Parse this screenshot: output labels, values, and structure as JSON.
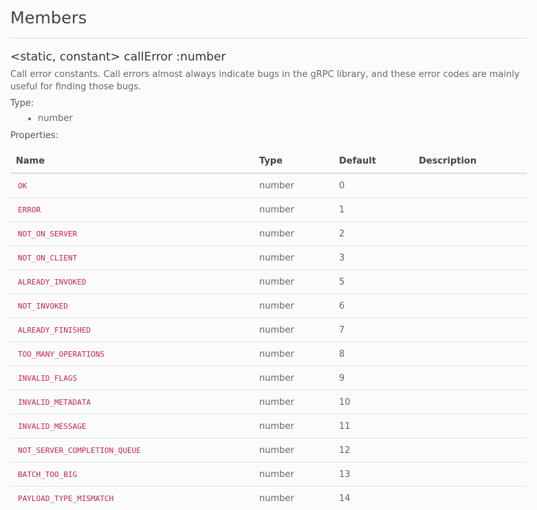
{
  "section_title": "Members",
  "member": {
    "signature": "<static, constant> callError :number",
    "description": "Call error constants. Call errors almost always indicate bugs in the gRPC library, and these error codes are mainly useful for finding those bugs.",
    "type_label": "Type:",
    "types": [
      "number"
    ],
    "properties_label": "Properties:"
  },
  "table": {
    "headers": {
      "name": "Name",
      "type": "Type",
      "default": "Default",
      "description": "Description"
    },
    "rows": [
      {
        "name": "OK",
        "type": "number",
        "default": "0",
        "description": ""
      },
      {
        "name": "ERROR",
        "type": "number",
        "default": "1",
        "description": ""
      },
      {
        "name": "NOT_ON_SERVER",
        "type": "number",
        "default": "2",
        "description": ""
      },
      {
        "name": "NOT_ON_CLIENT",
        "type": "number",
        "default": "3",
        "description": ""
      },
      {
        "name": "ALREADY_INVOKED",
        "type": "number",
        "default": "5",
        "description": ""
      },
      {
        "name": "NOT_INVOKED",
        "type": "number",
        "default": "6",
        "description": ""
      },
      {
        "name": "ALREADY_FINISHED",
        "type": "number",
        "default": "7",
        "description": ""
      },
      {
        "name": "TOO_MANY_OPERATIONS",
        "type": "number",
        "default": "8",
        "description": ""
      },
      {
        "name": "INVALID_FLAGS",
        "type": "number",
        "default": "9",
        "description": ""
      },
      {
        "name": "INVALID_METADATA",
        "type": "number",
        "default": "10",
        "description": ""
      },
      {
        "name": "INVALID_MESSAGE",
        "type": "number",
        "default": "11",
        "description": ""
      },
      {
        "name": "NOT_SERVER_COMPLETION_QUEUE",
        "type": "number",
        "default": "12",
        "description": ""
      },
      {
        "name": "BATCH_TOO_BIG",
        "type": "number",
        "default": "13",
        "description": ""
      },
      {
        "name": "PAYLOAD_TYPE_MISMATCH",
        "type": "number",
        "default": "14",
        "description": ""
      }
    ]
  }
}
